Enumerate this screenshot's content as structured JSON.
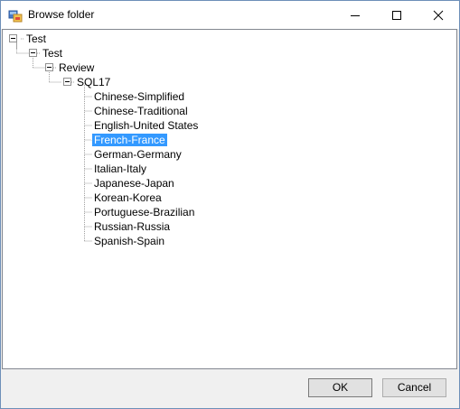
{
  "window": {
    "title": "Browse folder"
  },
  "tree": {
    "nodes": [
      {
        "label": "Test",
        "expanded": true
      },
      {
        "label": "Test",
        "expanded": true
      },
      {
        "label": "Review",
        "expanded": true
      },
      {
        "label": "SQL17",
        "expanded": true
      },
      {
        "label": "Chinese-Simplified"
      },
      {
        "label": "Chinese-Traditional"
      },
      {
        "label": "English-United States"
      },
      {
        "label": "French-France",
        "selected": true
      },
      {
        "label": "German-Germany"
      },
      {
        "label": "Italian-Italy"
      },
      {
        "label": "Japanese-Japan"
      },
      {
        "label": "Korean-Korea"
      },
      {
        "label": "Portuguese-Brazilian"
      },
      {
        "label": "Russian-Russia"
      },
      {
        "label": "Spanish-Spain"
      }
    ]
  },
  "buttons": {
    "ok_label": "OK",
    "cancel_label": "Cancel"
  },
  "colors": {
    "selection": "#3399ff",
    "window_border": "#6d8fb8"
  }
}
